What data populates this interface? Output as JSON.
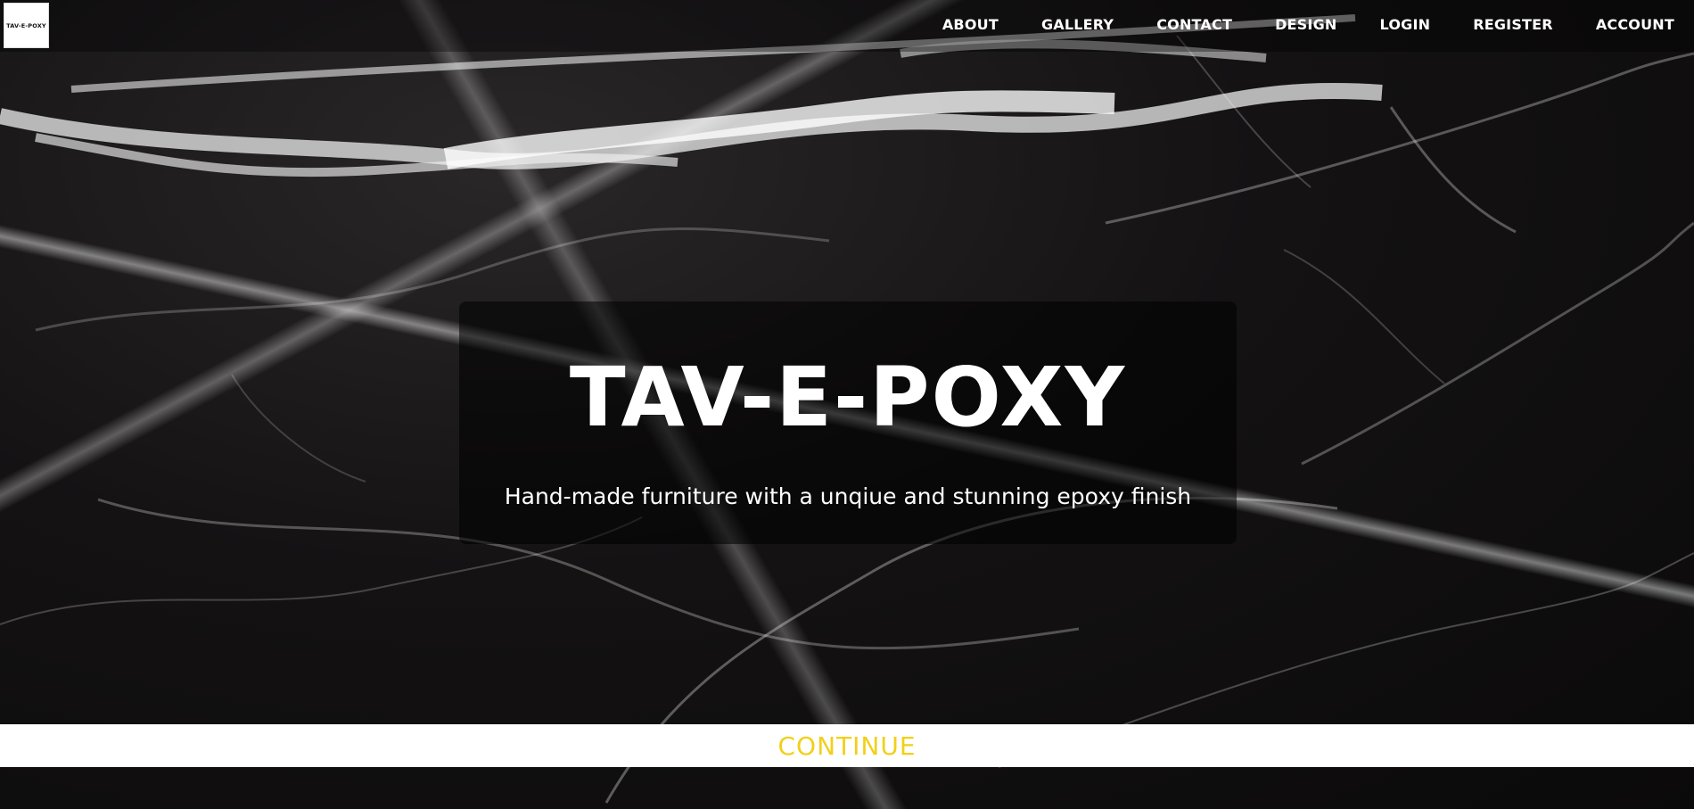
{
  "brand": {
    "logo_text": "TAV-E-POXY",
    "title": "TAV-E-POXY",
    "subtitle": "Hand-made furniture with a unqiue and stunning epoxy finish"
  },
  "nav": {
    "items": [
      {
        "label": "ABOUT"
      },
      {
        "label": "GALLERY"
      },
      {
        "label": "CONTACT"
      },
      {
        "label": "DESIGN"
      },
      {
        "label": "LOGIN"
      },
      {
        "label": "REGISTER"
      },
      {
        "label": "ACCOUNT"
      }
    ]
  },
  "continue": {
    "label": "CONTINUE",
    "color": "#f2d019"
  },
  "background": {
    "style": "black marble with white veins"
  }
}
